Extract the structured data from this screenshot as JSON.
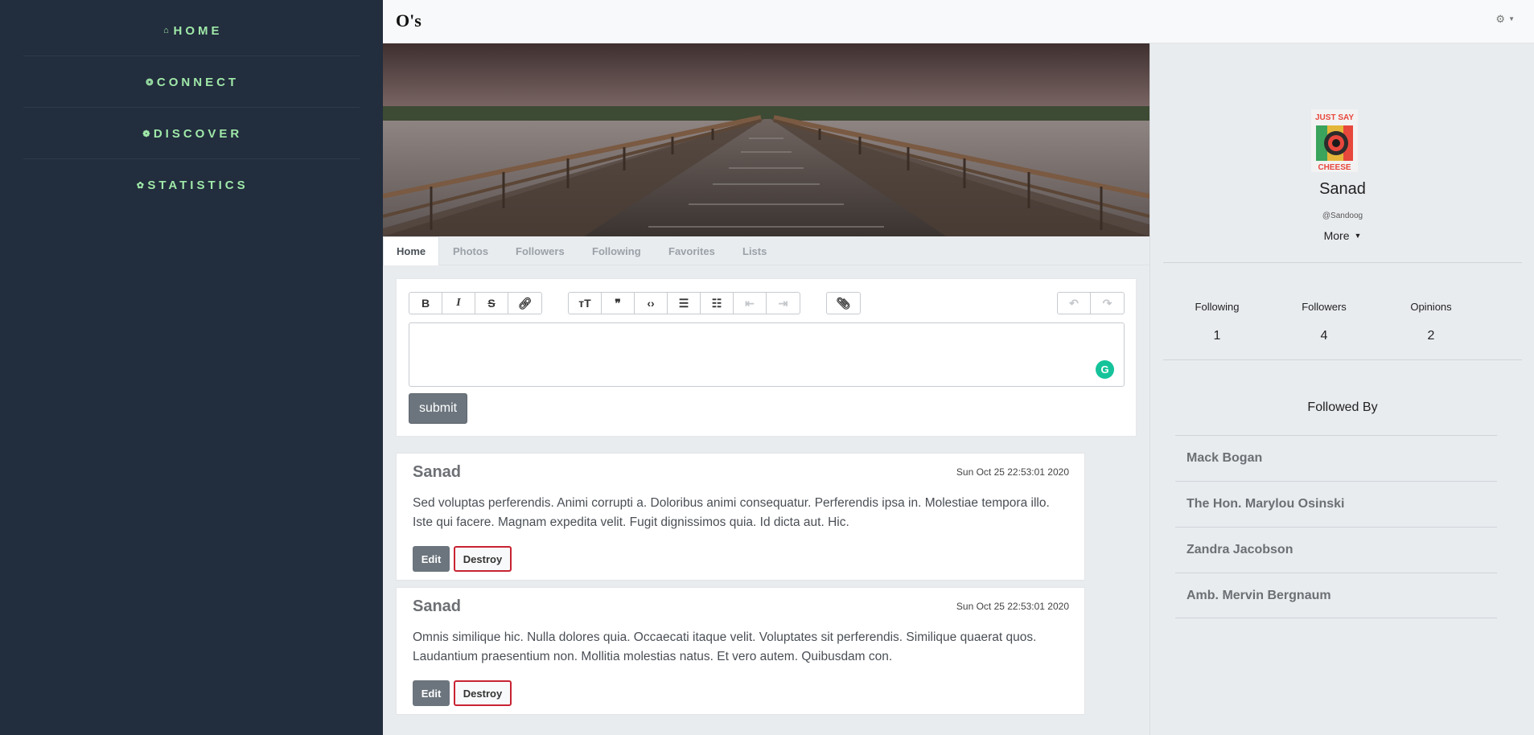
{
  "sidebar": {
    "items": [
      {
        "label": "HOME",
        "icon": "home-icon",
        "glyph": "⌂"
      },
      {
        "label": "CONNECT",
        "icon": "connect-icon",
        "glyph": "❂"
      },
      {
        "label": "DISCOVER",
        "icon": "discover-icon",
        "glyph": "❁"
      },
      {
        "label": "STATISTICS",
        "icon": "statistics-icon",
        "glyph": "✿"
      }
    ]
  },
  "header": {
    "brand": "O's",
    "settings_icon": "gear-icon"
  },
  "tabs": [
    "Home",
    "Photos",
    "Followers",
    "Following",
    "Favorites",
    "Lists"
  ],
  "editor": {
    "submit_label": "submit"
  },
  "posts": [
    {
      "author": "Sanad",
      "date": "Sun Oct 25 22:53:01 2020",
      "body": "Sed voluptas perferendis. Animi corrupti a. Doloribus animi consequatur. Perferendis ipsa in. Molestiae tempora illo. Iste qui facere. Magnam expedita velit. Fugit dignissimos quia. Id dicta aut. Hic.",
      "edit_label": "Edit",
      "destroy_label": "Destroy"
    },
    {
      "author": "Sanad",
      "date": "Sun Oct 25 22:53:01 2020",
      "body": "Omnis similique hic. Nulla dolores quia. Occaecati itaque velit. Voluptates sit perferendis. Similique quaerat quos. Laudantium praesentium non. Mollitia molestias natus. Et vero autem. Quibusdam con.",
      "edit_label": "Edit",
      "destroy_label": "Destroy"
    }
  ],
  "profile": {
    "avatar_text_top": "JUST SAY",
    "avatar_text_bottom": "CHEESE",
    "name": "Sanad",
    "handle": "@Sandoog",
    "more_label": "More",
    "stats": [
      {
        "label": "Following",
        "value": "1"
      },
      {
        "label": "Followers",
        "value": "4"
      },
      {
        "label": "Opinions",
        "value": "2"
      }
    ],
    "followed_by_title": "Followed By",
    "followed_by": [
      "Mack Bogan",
      "The Hon. Marylou Osinski",
      "Zandra Jacobson",
      "Amb. Mervin Bergnaum"
    ]
  }
}
